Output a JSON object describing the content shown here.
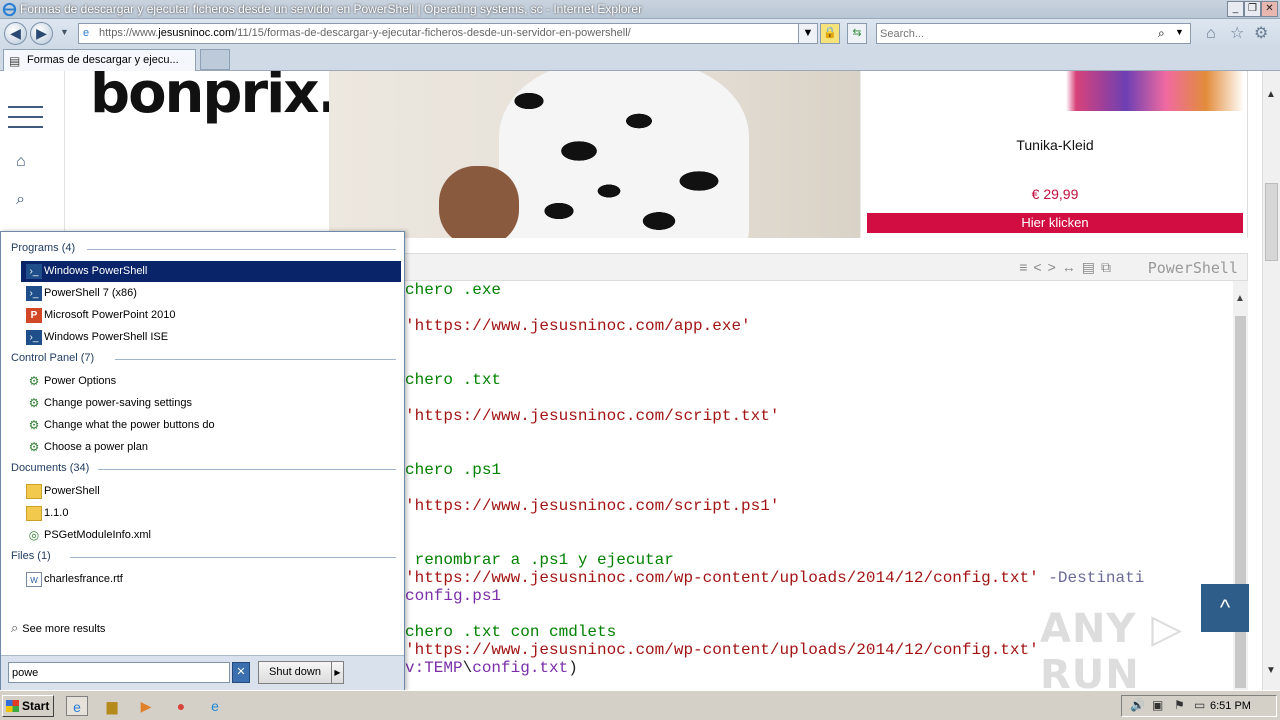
{
  "window": {
    "title": "Formas de descargar y ejecutar ficheros desde un servidor en PowerShell | Operating systems, sc - Internet Explorer",
    "minimize": "_",
    "restore": "❐",
    "close": "✕"
  },
  "address_bar": {
    "url_prefix": "https://www.",
    "url_domain": "jesusninoc.com",
    "url_path": "/11/15/formas-de-descargar-y-ejecutar-ficheros-desde-un-servidor-en-powershell/",
    "search_placeholder": "Search..."
  },
  "tabs": [
    {
      "label": "Formas de descargar y ejecu...",
      "active": true
    }
  ],
  "site_sidebar": {
    "icons": [
      "menu-icon",
      "home-icon",
      "search-icon"
    ]
  },
  "ad": {
    "brand": "bonprix.",
    "product_name": "Tunika-Kleid",
    "price": "€ 29,99",
    "cta": "Hier klicken"
  },
  "code_block": {
    "language": "PowerShell",
    "lines": [
      {
        "segments": [
          {
            "cls": "c-cmt",
            "text": "chero .exe"
          }
        ]
      },
      {
        "segments": [
          {
            "cls": "c-str",
            "text": "'https://www.jesusninoc.com/app.exe'"
          }
        ]
      },
      {
        "segments": [
          {
            "cls": "c-cmt",
            "text": "chero .txt"
          }
        ]
      },
      {
        "segments": [
          {
            "cls": "c-str",
            "text": "'https://www.jesusninoc.com/script.txt'"
          }
        ]
      },
      {
        "segments": [
          {
            "cls": "c-cmt",
            "text": "chero .ps1"
          }
        ]
      },
      {
        "segments": [
          {
            "cls": "c-str",
            "text": "'https://www.jesusninoc.com/script.ps1'"
          }
        ]
      },
      {
        "segments": [
          {
            "cls": "c-cmt",
            "text": " renombrar a .ps1 y ejecutar"
          }
        ]
      },
      {
        "segments": [
          {
            "cls": "c-str",
            "text": "'https://www.jesusninoc.com/wp-content/uploads/2014/12/config.txt'"
          },
          {
            "cls": "c-op",
            "text": " -Destinati"
          }
        ]
      },
      {
        "segments": [
          {
            "cls": "c-var",
            "text": "config.ps1"
          }
        ]
      },
      {
        "segments": [
          {
            "cls": "c-cmt",
            "text": "chero .txt con cmdlets"
          }
        ]
      },
      {
        "segments": [
          {
            "cls": "c-str",
            "text": "'https://www.jesusninoc.com/wp-content/uploads/2014/12/config.txt'"
          }
        ]
      },
      {
        "segments": [
          {
            "cls": "c-var",
            "text": "v:TEMP"
          },
          {
            "cls": "c-txt",
            "text": "\\"
          },
          {
            "cls": "c-var",
            "text": "config.txt"
          },
          {
            "cls": "c-txt",
            "text": ")"
          }
        ]
      }
    ],
    "back_to_top": "^"
  },
  "watermark": "ANY ▷ RUN",
  "start_menu": {
    "groups": [
      {
        "heading": "Programs (4)",
        "items": [
          {
            "label": "Windows PowerShell",
            "icon": "powershell-icon",
            "selected": true
          },
          {
            "label": "PowerShell 7 (x86)",
            "icon": "powershell-icon",
            "selected": false
          },
          {
            "label": "Microsoft PowerPoint 2010",
            "icon": "powerpoint-icon",
            "selected": false
          },
          {
            "label": "Windows PowerShell ISE",
            "icon": "powershell-ise-icon",
            "selected": false
          }
        ]
      },
      {
        "heading": "Control Panel (7)",
        "items": [
          {
            "label": "Power Options",
            "icon": "control-panel-icon",
            "selected": false
          },
          {
            "label": "Change power-saving settings",
            "icon": "control-panel-icon",
            "selected": false
          },
          {
            "label": "Change what the power buttons do",
            "icon": "control-panel-icon",
            "selected": false
          },
          {
            "label": "Choose a power plan",
            "icon": "control-panel-icon",
            "selected": false
          }
        ]
      },
      {
        "heading": "Documents (34)",
        "items": [
          {
            "label": "PowerShell",
            "icon": "folder-icon",
            "selected": false
          },
          {
            "label": "1.1.0",
            "icon": "folder-icon",
            "selected": false
          },
          {
            "label": "PSGetModuleInfo.xml",
            "icon": "xml-file-icon",
            "selected": false
          }
        ]
      },
      {
        "heading": "Files (1)",
        "items": [
          {
            "label": "charlesfrance.rtf",
            "icon": "word-document-icon",
            "selected": false
          }
        ]
      }
    ],
    "see_more": "See more results",
    "search_value": "powe",
    "shutdown_label": "Shut down"
  },
  "taskbar": {
    "start_label": "Start",
    "clock": "6:51 PM"
  }
}
